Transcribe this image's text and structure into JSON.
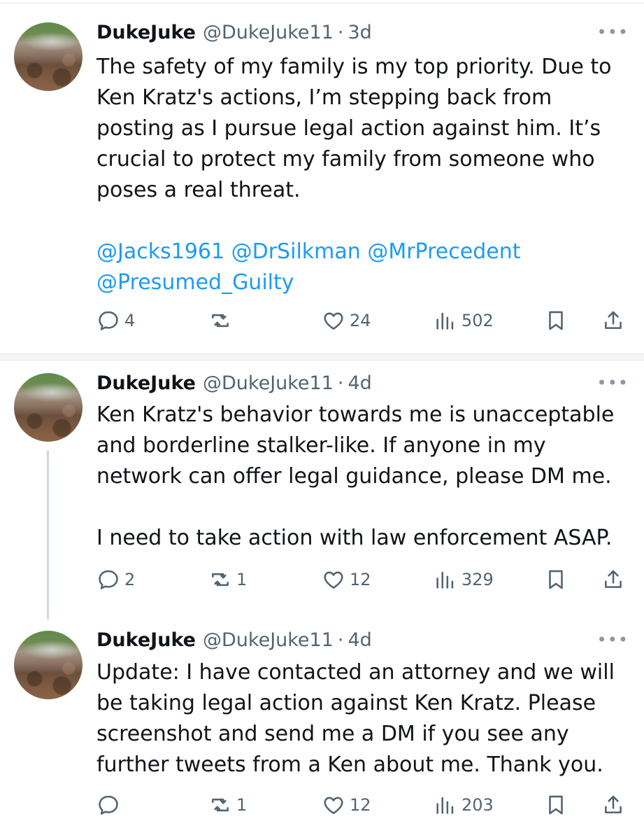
{
  "tweets": [
    {
      "name": "DukeJuke",
      "handle": "@DukeJuke11",
      "dot": "·",
      "time": "3d",
      "more": "•••",
      "text": [
        "The safety of my family is my top priority. Due to Ken Kratz's actions, I’m stepping back from posting as I pursue legal action against him. It’s crucial to protect my family from someone who poses a real threat."
      ],
      "mentions": [
        "@Jacks1961",
        "@DrSilkman",
        "@MrPrecedent",
        "@Presumed_Guilty"
      ],
      "replies": "4",
      "retweets": "",
      "likes": "24",
      "views": "502"
    },
    {
      "name": "DukeJuke",
      "handle": "@DukeJuke11",
      "dot": "·",
      "time": "4d",
      "more": "•••",
      "text": [
        "Ken Kratz's behavior towards me is unacceptable and borderline stalker-like. If anyone in my network can offer legal guidance, please DM me.",
        "I need to take action with law enforcement ASAP."
      ],
      "replies": "2",
      "retweets": "1",
      "likes": "12",
      "views": "329"
    },
    {
      "name": "DukeJuke",
      "handle": "@DukeJuke11",
      "dot": "·",
      "time": "4d",
      "more": "•••",
      "text": [
        "Update: I have contacted an attorney and we will be taking legal action against Ken Kratz. Please screenshot and send me a DM if you see any further tweets from a Ken about me. Thank you."
      ],
      "replies": "",
      "retweets": "1",
      "likes": "12",
      "views": "203"
    }
  ],
  "icons": {
    "reply": "reply-icon",
    "retweet": "retweet-icon",
    "like": "heart-icon",
    "views": "views-icon",
    "bookmark": "bookmark-icon",
    "share": "share-icon"
  },
  "colors": {
    "mention": "#1d9bf0",
    "secondary_text": "#536471",
    "primary_text": "#0f1419"
  }
}
